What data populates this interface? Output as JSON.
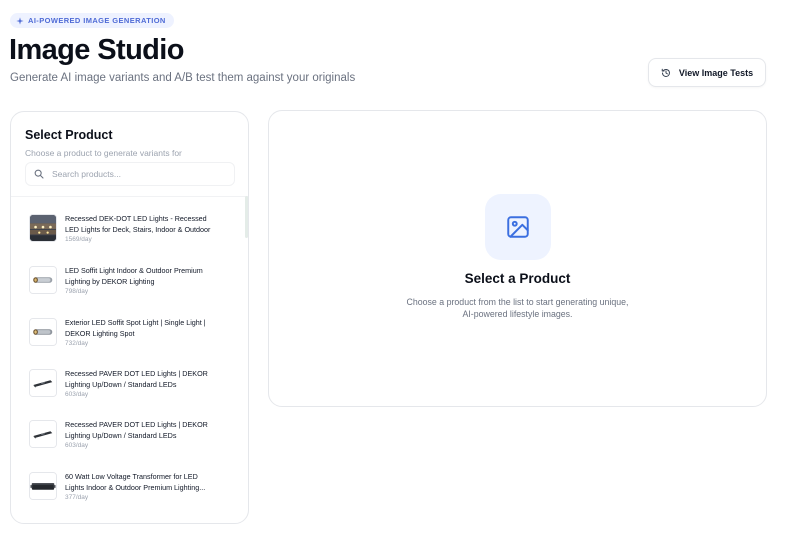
{
  "header": {
    "badge": "AI-POWERED IMAGE GENERATION",
    "title": "Image Studio",
    "subtitle": "Generate AI image variants and A/B test them against your originals",
    "view_tests_label": "View Image Tests"
  },
  "product_panel": {
    "title": "Select Product",
    "subtitle": "Choose a product to generate variants for",
    "search_placeholder": "Search products...",
    "search_value": "",
    "products": [
      {
        "name": "Recessed DEK-DOT LED Lights - Recessed LED Lights for Deck, Stairs, Indoor & Outdoor",
        "meta": "1569/day",
        "icon": "deck-lights-photo-icon"
      },
      {
        "name": "LED Soffit Light Indoor & Outdoor Premium Lighting by DEKOR Lighting",
        "meta": "798/day",
        "icon": "soffit-light-icon"
      },
      {
        "name": "Exterior LED Soffit Spot Light | Single Light | DEKOR Lighting Spot",
        "meta": "732/day",
        "icon": "soffit-spot-icon"
      },
      {
        "name": "Recessed PAVER DOT LED Lights | DEKOR Lighting Up/Down / Standard LEDs",
        "meta": "603/day",
        "icon": "paver-light-icon"
      },
      {
        "name": "Recessed PAVER DOT LED Lights | DEKOR Lighting Up/Down / Standard LEDs",
        "meta": "603/day",
        "icon": "paver-light-icon"
      },
      {
        "name": "60 Watt Low Voltage Transformer for LED Lights Indoor & Outdoor Premium Lighting...",
        "meta": "377/day",
        "icon": "transformer-icon"
      }
    ]
  },
  "preview": {
    "empty_title": "Select a Product",
    "empty_text_line1": "Choose a product from the list to start generating unique,",
    "empty_text_line2": "AI-powered lifestyle images."
  },
  "colors": {
    "badge_bg": "#eef2ff",
    "badge_text": "#4f6bd6",
    "accent": "#3b6fe0",
    "icon_bg": "#eef3ff",
    "border": "#e5e7eb",
    "muted_text": "#6b7280"
  }
}
